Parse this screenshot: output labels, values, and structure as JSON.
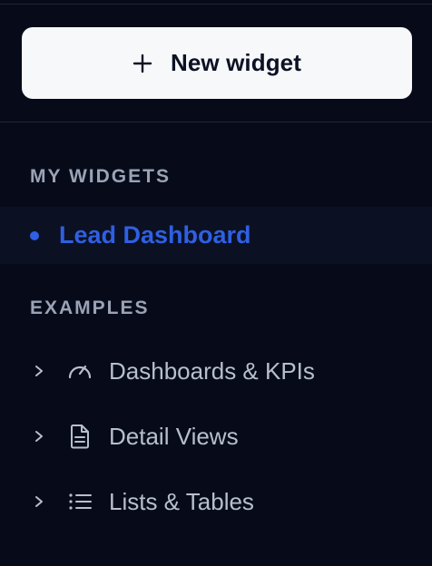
{
  "new_widget_button": {
    "label": "New widget",
    "icon": "plus-icon"
  },
  "sections": {
    "my_widgets": {
      "heading": "MY WIDGETS",
      "items": [
        {
          "label": "Lead Dashboard",
          "active": true,
          "icon": "dot-indicator"
        }
      ]
    },
    "examples": {
      "heading": "EXAMPLES",
      "items": [
        {
          "label": "Dashboards & KPIs",
          "icon": "gauge-icon",
          "expander": "chevron-right-icon"
        },
        {
          "label": "Detail Views",
          "icon": "document-icon",
          "expander": "chevron-right-icon"
        },
        {
          "label": "Lists & Tables",
          "icon": "list-icon",
          "expander": "chevron-right-icon"
        }
      ]
    }
  },
  "colors": {
    "background": "#070b19",
    "active_row_bg": "#0b1122",
    "accent": "#2f5fe3",
    "heading_text": "#9aa3b5",
    "item_text": "#b7bfce",
    "button_bg": "#f7f8fa",
    "button_text": "#0c1224"
  }
}
